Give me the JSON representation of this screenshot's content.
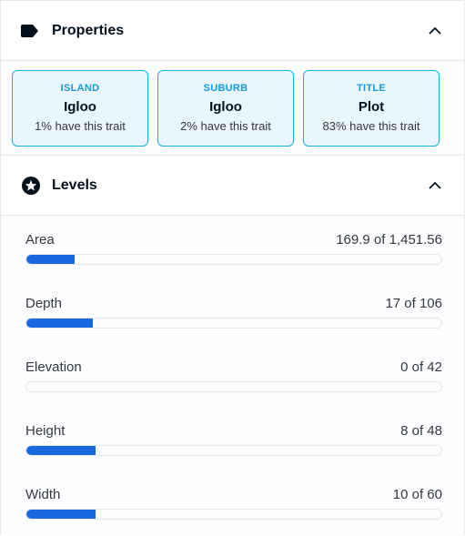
{
  "properties": {
    "title": "Properties",
    "icon": "tag-icon",
    "items": [
      {
        "type": "ISLAND",
        "value": "Igloo",
        "rarity": "1% have this trait"
      },
      {
        "type": "SUBURB",
        "value": "Igloo",
        "rarity": "2% have this trait"
      },
      {
        "type": "TITLE",
        "value": "Plot",
        "rarity": "83% have this trait"
      }
    ]
  },
  "levels": {
    "title": "Levels",
    "icon": "star-icon",
    "items": [
      {
        "name": "Area",
        "value_text": "169.9 of 1,451.56",
        "value": 169.9,
        "max": 1451.56
      },
      {
        "name": "Depth",
        "value_text": "17 of 106",
        "value": 17,
        "max": 106
      },
      {
        "name": "Elevation",
        "value_text": "0 of 42",
        "value": 0,
        "max": 42
      },
      {
        "name": "Height",
        "value_text": "8 of 48",
        "value": 8,
        "max": 48
      },
      {
        "name": "Width",
        "value_text": "10 of 60",
        "value": 10,
        "max": 60
      }
    ]
  },
  "colors": {
    "accent": "#1868e0",
    "card_border": "#15b2e5",
    "card_bg": "#e9f6fd",
    "trait_type": "#1a9bd7"
  }
}
